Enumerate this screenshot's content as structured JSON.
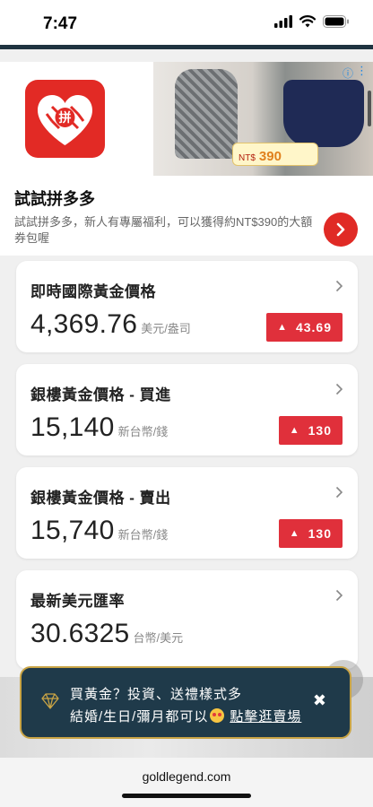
{
  "status_bar": {
    "time": "7:47"
  },
  "ad": {
    "title": "試試拼多多",
    "description": "試試拼多多，新人有專屬福利，可以獲得約NT$390的大額券包喔",
    "logo_text": "拼",
    "promo_price": "390"
  },
  "cards": [
    {
      "title": "即時國際黃金價格",
      "value": "4,369.76",
      "unit": "美元/盎司",
      "change": "43.69",
      "direction": "up"
    },
    {
      "title": "銀樓黃金價格 - 買進",
      "value": "15,140",
      "unit": "新台幣/錢",
      "change": "130",
      "direction": "up"
    },
    {
      "title": "銀樓黃金價格 - 賣出",
      "value": "15,740",
      "unit": "新台幣/錢",
      "change": "130",
      "direction": "up"
    },
    {
      "title": "最新美元匯率",
      "value": "30.6325",
      "unit": "台幣/美元"
    }
  ],
  "promo": {
    "line1": "買黃金？投資、送禮樣式多",
    "line2_prefix": "結婚/生日/彌月都可以",
    "link_text": "點擊逛賣場",
    "close": "✖"
  },
  "browser": {
    "url": "goldlegend.com"
  },
  "colors": {
    "up_badge": "#e0303b",
    "banner_bg": "#1f3a4a",
    "banner_border": "#c9a445",
    "ad_red": "#e22a25"
  },
  "icons": [
    "signal-icon",
    "wifi-icon",
    "battery-icon",
    "chevron-right-icon",
    "diamond-icon",
    "close-icon",
    "arrow-right-icon",
    "triangle-up-icon"
  ]
}
